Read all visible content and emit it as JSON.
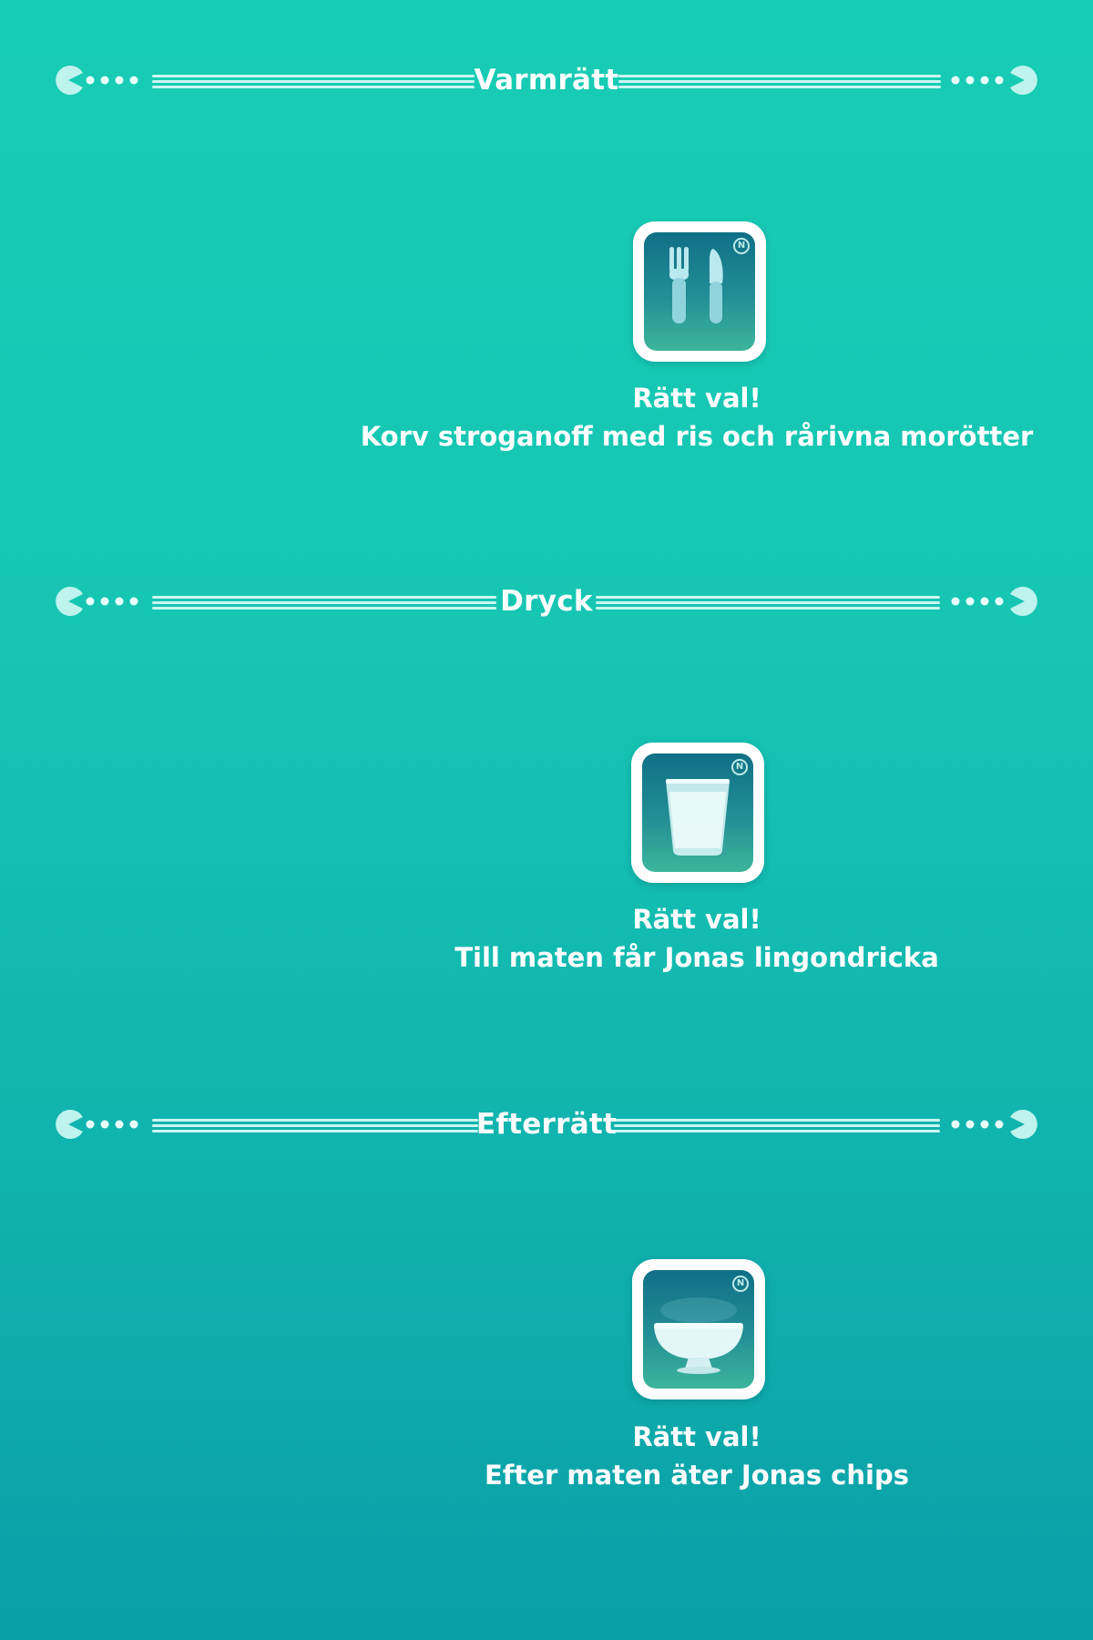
{
  "sections": [
    {
      "title": "Varmrätt",
      "icon": "fork-knife-icon",
      "badge": "N",
      "result_heading": "Rätt val!",
      "result_text": "Korv stroganoff med ris och rårivna morötter"
    },
    {
      "title": "Dryck",
      "icon": "glass-icon",
      "badge": "N",
      "result_heading": "Rätt val!",
      "result_text": "Till maten får Jonas lingondricka"
    },
    {
      "title": "Efterrätt",
      "icon": "dessert-bowl-icon",
      "badge": "N",
      "result_heading": "Rätt val!",
      "result_text": "Efter maten äter Jonas chips"
    }
  ],
  "colors": {
    "background_top": "#17ccb4",
    "background_bottom": "#0a9fa8",
    "card_inner_top": "#0f6f87",
    "card_inner_bottom": "#3cb59c",
    "accent_light": "#bff3ee"
  }
}
